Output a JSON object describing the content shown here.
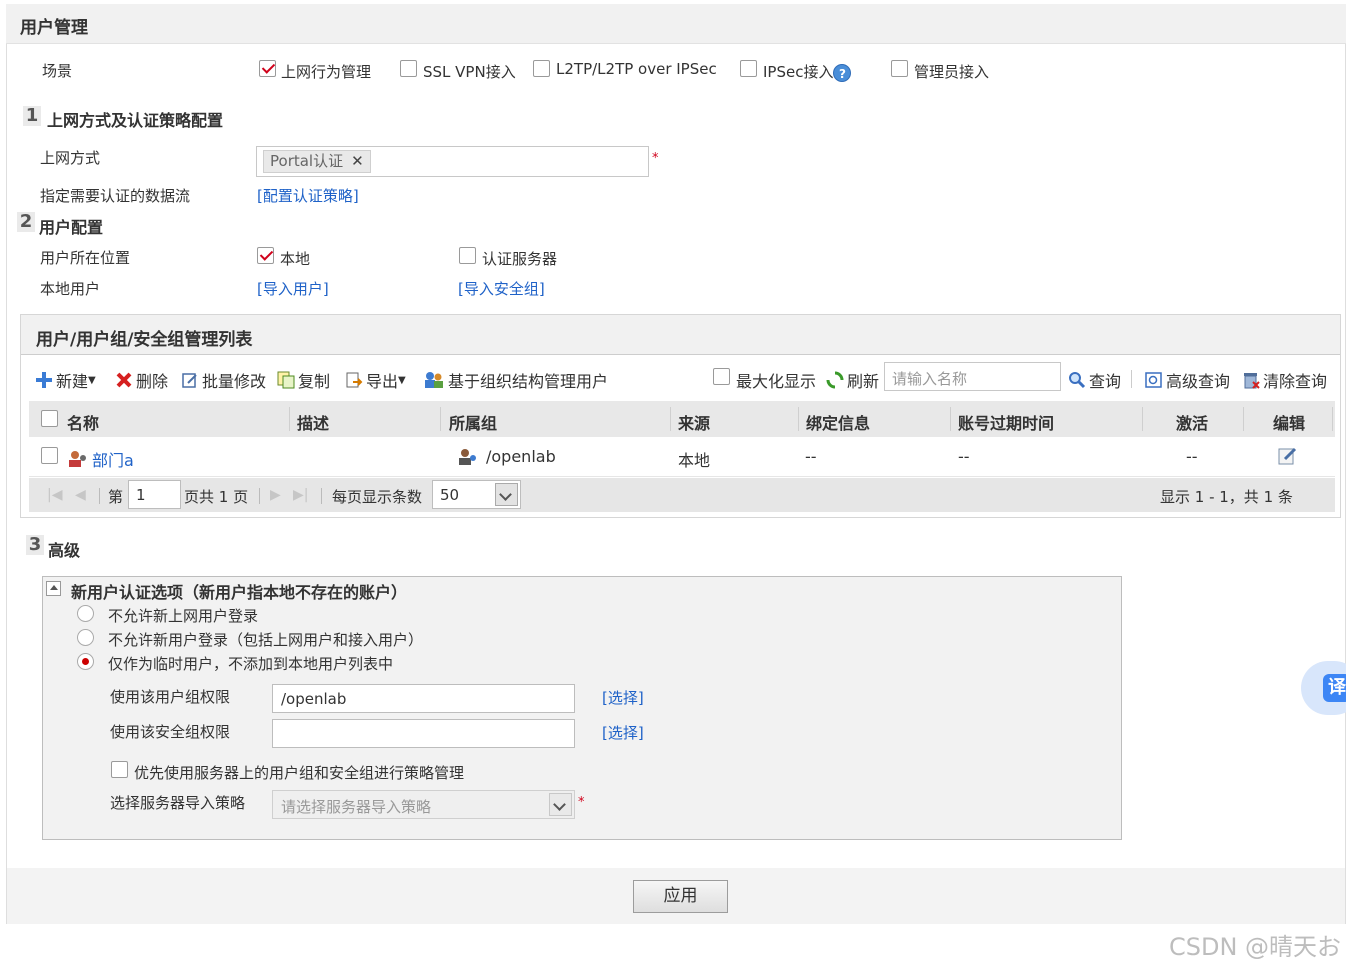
{
  "page": {
    "title": "用户管理"
  },
  "scenario": {
    "label": "场景",
    "options": [
      {
        "label": "上网行为管理",
        "checked": true
      },
      {
        "label": "SSL VPN接入",
        "checked": false
      },
      {
        "label": "L2TP/L2TP over IPSec",
        "checked": false
      },
      {
        "label": "IPSec接入",
        "checked": false
      },
      {
        "label": "管理员接入",
        "checked": false
      }
    ],
    "help_icon": "?"
  },
  "section1": {
    "num": "1",
    "title": "上网方式及认证策略配置",
    "mode_label": "上网方式",
    "mode_tag": "Portal认证",
    "mode_tag_remove": "✕",
    "required_mark": "*",
    "flow_label": "指定需要认证的数据流",
    "flow_link": "[配置认证策略]"
  },
  "section2": {
    "num": "2",
    "title": "用户配置",
    "location_label": "用户所在位置",
    "loc_local": "本地",
    "loc_local_checked": true,
    "loc_server": "认证服务器",
    "loc_server_checked": false,
    "local_user_label": "本地用户",
    "import_user_link": "[导入用户]",
    "import_group_link": "[导入安全组]"
  },
  "list_panel": {
    "title": "用户/用户组/安全组管理列表",
    "toolbar": {
      "new": "新建",
      "delete": "删除",
      "batch_edit": "批量修改",
      "copy": "复制",
      "export": "导出",
      "org_manage": "基于组织结构管理用户",
      "maximize": "最大化显示",
      "refresh": "刷新",
      "search_placeholder": "请输入名称",
      "query": "查询",
      "adv_query": "高级查询",
      "clear_query": "清除查询"
    },
    "columns": [
      "名称",
      "描述",
      "所属组",
      "来源",
      "绑定信息",
      "账号过期时间",
      "激活",
      "编辑"
    ],
    "rows": [
      {
        "name": "部门a",
        "desc": "",
        "group": "/openlab",
        "source": "本地",
        "binding": "--",
        "expire": "--",
        "active": "--"
      }
    ],
    "pager": {
      "page_prefix": "第",
      "page_value": "1",
      "page_suffix": "页共 1 页",
      "per_page_label": "每页显示条数",
      "per_page_value": "50",
      "summary": "显示 1 - 1，共 1 条"
    }
  },
  "section3": {
    "num": "3",
    "title": "高级",
    "box_title": "新用户认证选项（新用户指本地不存在的账户）",
    "radios": [
      {
        "label": "不允许新上网用户登录",
        "selected": false
      },
      {
        "label": "不允许新用户登录（包括上网用户和接入用户）",
        "selected": false
      },
      {
        "label": "仅作为临时用户，不添加到本地用户列表中",
        "selected": true
      }
    ],
    "group_perm_label": "使用该用户组权限",
    "group_perm_value": "/openlab",
    "group_select_link": "[选择]",
    "sec_perm_label": "使用该安全组权限",
    "sec_perm_value": "",
    "sec_select_link": "[选择]",
    "prefer_server_label": "优先使用服务器上的用户组和安全组进行策略管理",
    "prefer_server_checked": false,
    "import_policy_label": "选择服务器导入策略",
    "import_policy_placeholder": "请选择服务器导入策略",
    "required_mark": "*"
  },
  "apply_button": "应用",
  "watermark": "CSDN @晴天お",
  "translate_button": "译"
}
